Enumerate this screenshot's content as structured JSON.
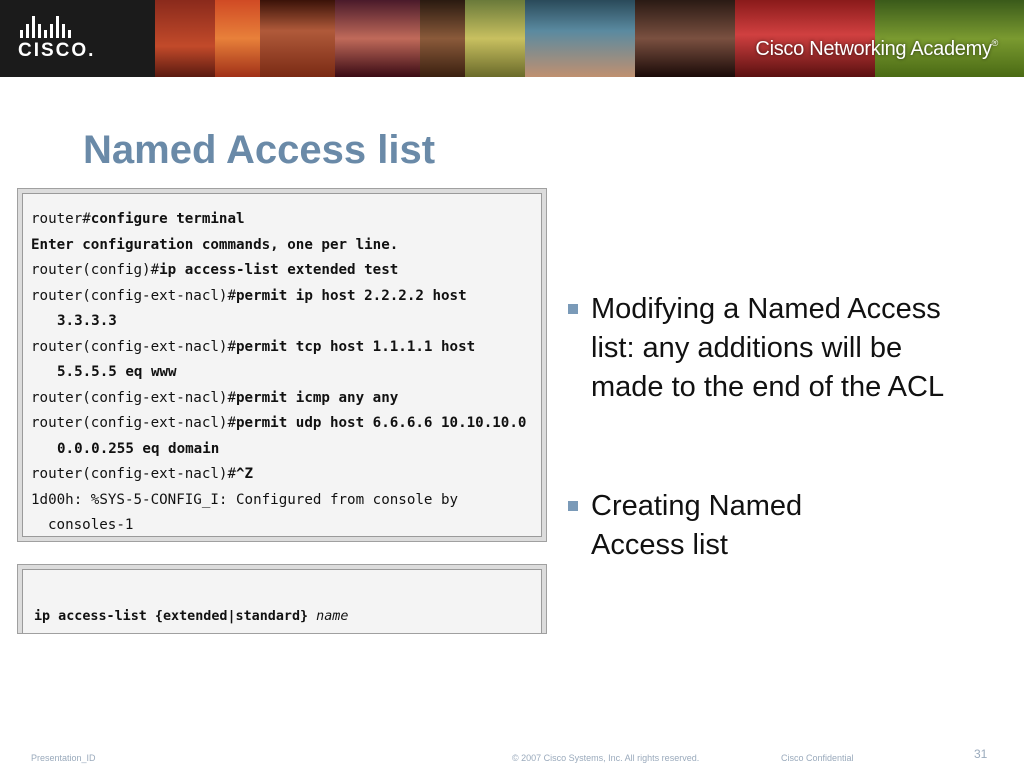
{
  "header": {
    "brand_word": "CISCO.",
    "academy_title": "Cisco Networking Academy",
    "academy_reg": "®"
  },
  "slide": {
    "title": "Named Access list"
  },
  "cli_config": {
    "lines": [
      {
        "prompt": "router#",
        "cmd": "configure terminal"
      },
      {
        "prompt": "",
        "cmd": "Enter configuration commands, one per line."
      },
      {
        "prompt": "router(config)#",
        "cmd": "ip access-list extended test"
      },
      {
        "prompt": "router(config-ext-nacl)#",
        "cmd": "permit ip host 2.2.2.2 host"
      },
      {
        "prompt": "",
        "cmd": "3.3.3.3"
      },
      {
        "prompt": "router(config-ext-nacl)#",
        "cmd": "permit tcp host 1.1.1.1 host"
      },
      {
        "prompt": "",
        "cmd": "5.5.5.5 eq www"
      },
      {
        "prompt": "router(config-ext-nacl)#",
        "cmd": "permit icmp any any"
      },
      {
        "prompt": "router(config-ext-nacl)#",
        "cmd": "permit udp host 6.6.6.6 10.10.10.0"
      },
      {
        "prompt": "",
        "cmd": "0.0.0.255 eq domain"
      },
      {
        "prompt": "router(config-ext-nacl)#",
        "cmd": "^Z"
      },
      {
        "prompt": "1d00h: %SYS-5-CONFIG_I: Configured from console by",
        "cmd": ""
      },
      {
        "prompt": "consoles-1",
        "cmd": ""
      }
    ]
  },
  "cli_syntax": {
    "command": "ip access-list {extended|standard}",
    "argument": "name"
  },
  "bullets": [
    {
      "text": "Modifying a Named Access list: any additions will be made to the end of the ACL"
    },
    {
      "text": "Creating Named Access list"
    }
  ],
  "footer": {
    "presentation_id": "Presentation_ID",
    "copyright": "© 2007 Cisco Systems, Inc. All rights reserved.",
    "confidential": "Cisco Confidential",
    "page_number": "31"
  },
  "colors": {
    "title": "#6a8aa8",
    "bullet_marker": "#7a9ab8",
    "footer_text": "#9aaabc",
    "banner_bg": "#1b1b1b"
  }
}
